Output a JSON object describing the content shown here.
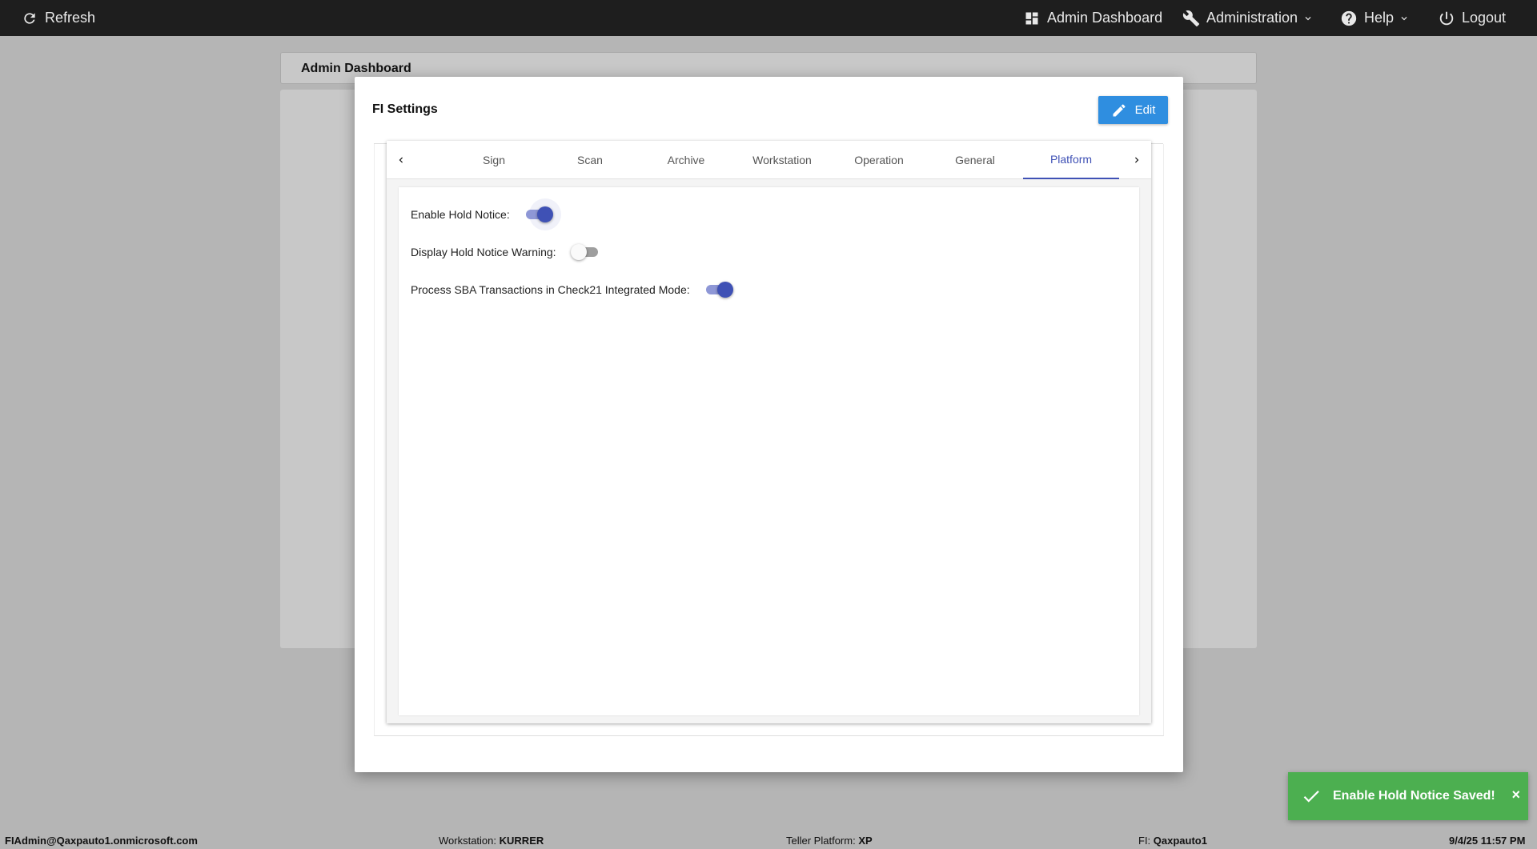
{
  "topbar": {
    "refresh_label": "Refresh",
    "admin_dashboard_label": "Admin Dashboard",
    "administration_label": "Administration",
    "help_label": "Help",
    "logout_label": "Logout"
  },
  "background": {
    "page_title": "Admin Dashboard"
  },
  "modal": {
    "title": "FI Settings",
    "edit_label": "Edit",
    "tabs": [
      {
        "label": "Sign",
        "active": false
      },
      {
        "label": "Scan",
        "active": false
      },
      {
        "label": "Archive",
        "active": false
      },
      {
        "label": "Workstation",
        "active": false
      },
      {
        "label": "Operation",
        "active": false
      },
      {
        "label": "General",
        "active": false
      },
      {
        "label": "Platform",
        "active": true
      }
    ],
    "settings": [
      {
        "label": "Enable Hold Notice:",
        "enabled": true
      },
      {
        "label": "Display Hold Notice Warning:",
        "enabled": false
      },
      {
        "label": "Process SBA Transactions in Check21 Integrated Mode:",
        "enabled": true
      }
    ]
  },
  "toast": {
    "message": "Enable Hold Notice Saved!",
    "close_symbol": "×",
    "color": "#4caf50"
  },
  "statusbar": {
    "user": "FIAdmin@Qaxpauto1.onmicrosoft.com",
    "workstation_label": "Workstation:",
    "workstation_value": "KURRER",
    "teller_platform_label": "Teller Platform:",
    "teller_platform_value": "XP",
    "fi_label": "FI:",
    "fi_value": "Qaxpauto1",
    "datetime": "9/4/25 11:57 PM"
  },
  "colors": {
    "accent": "#3f51b5",
    "edit_button": "#2f8ee0",
    "topbar": "#1e1e1e"
  }
}
